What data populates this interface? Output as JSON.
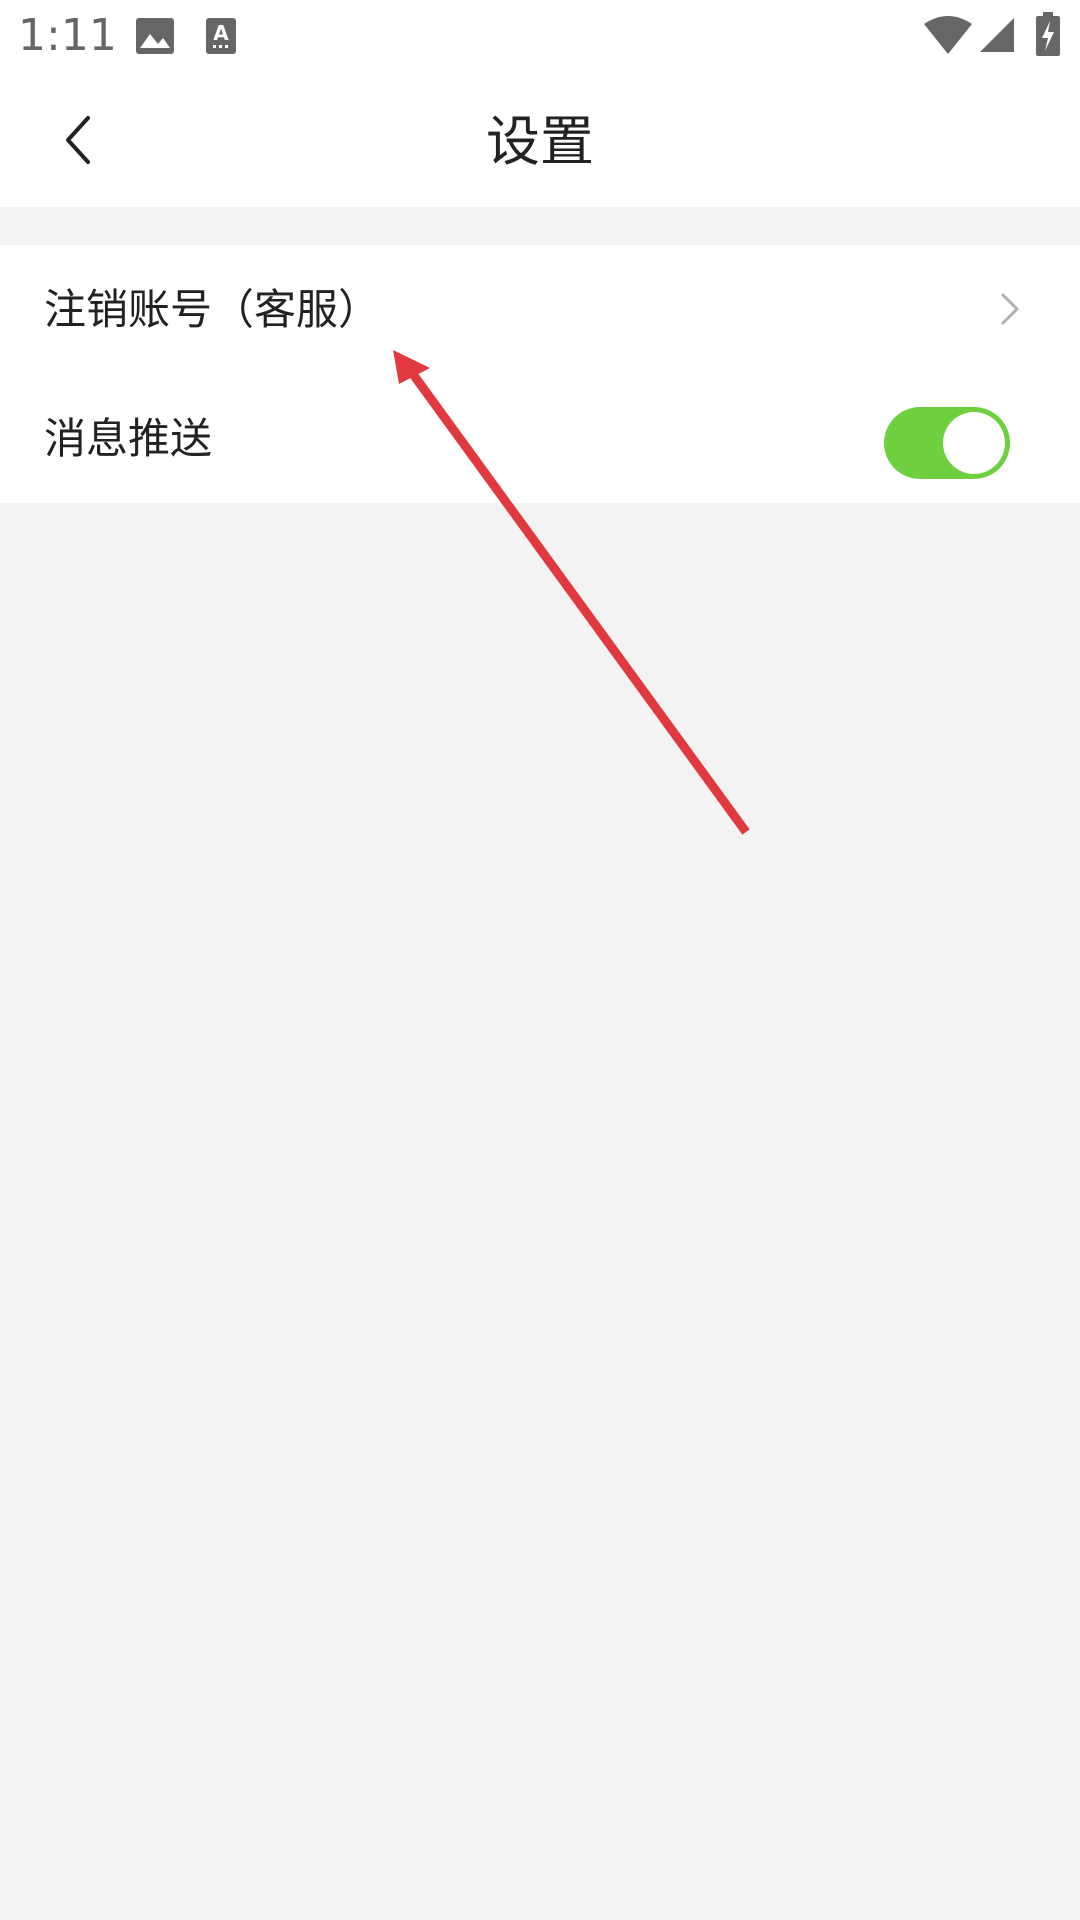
{
  "status_bar": {
    "time": "1:11",
    "icons": [
      "gallery-icon",
      "keyboard-a-icon",
      "wifi-icon",
      "cellular-signal-icon",
      "battery-charging-icon"
    ],
    "icon_color": "#666666"
  },
  "header": {
    "title": "设置",
    "back_icon": "chevron-left-icon"
  },
  "settings": {
    "items": [
      {
        "label": "注销账号（客服）",
        "trailing": "chevron-right-icon"
      },
      {
        "label": "消息推送",
        "trailing": "toggle",
        "toggle_on": true
      }
    ]
  },
  "colors": {
    "background": "#f3f3f3",
    "surface": "#ffffff",
    "toggle_on": "#6ecf3f",
    "annotation_arrow": "#e0393e",
    "chevron": "#b0b0b0"
  }
}
